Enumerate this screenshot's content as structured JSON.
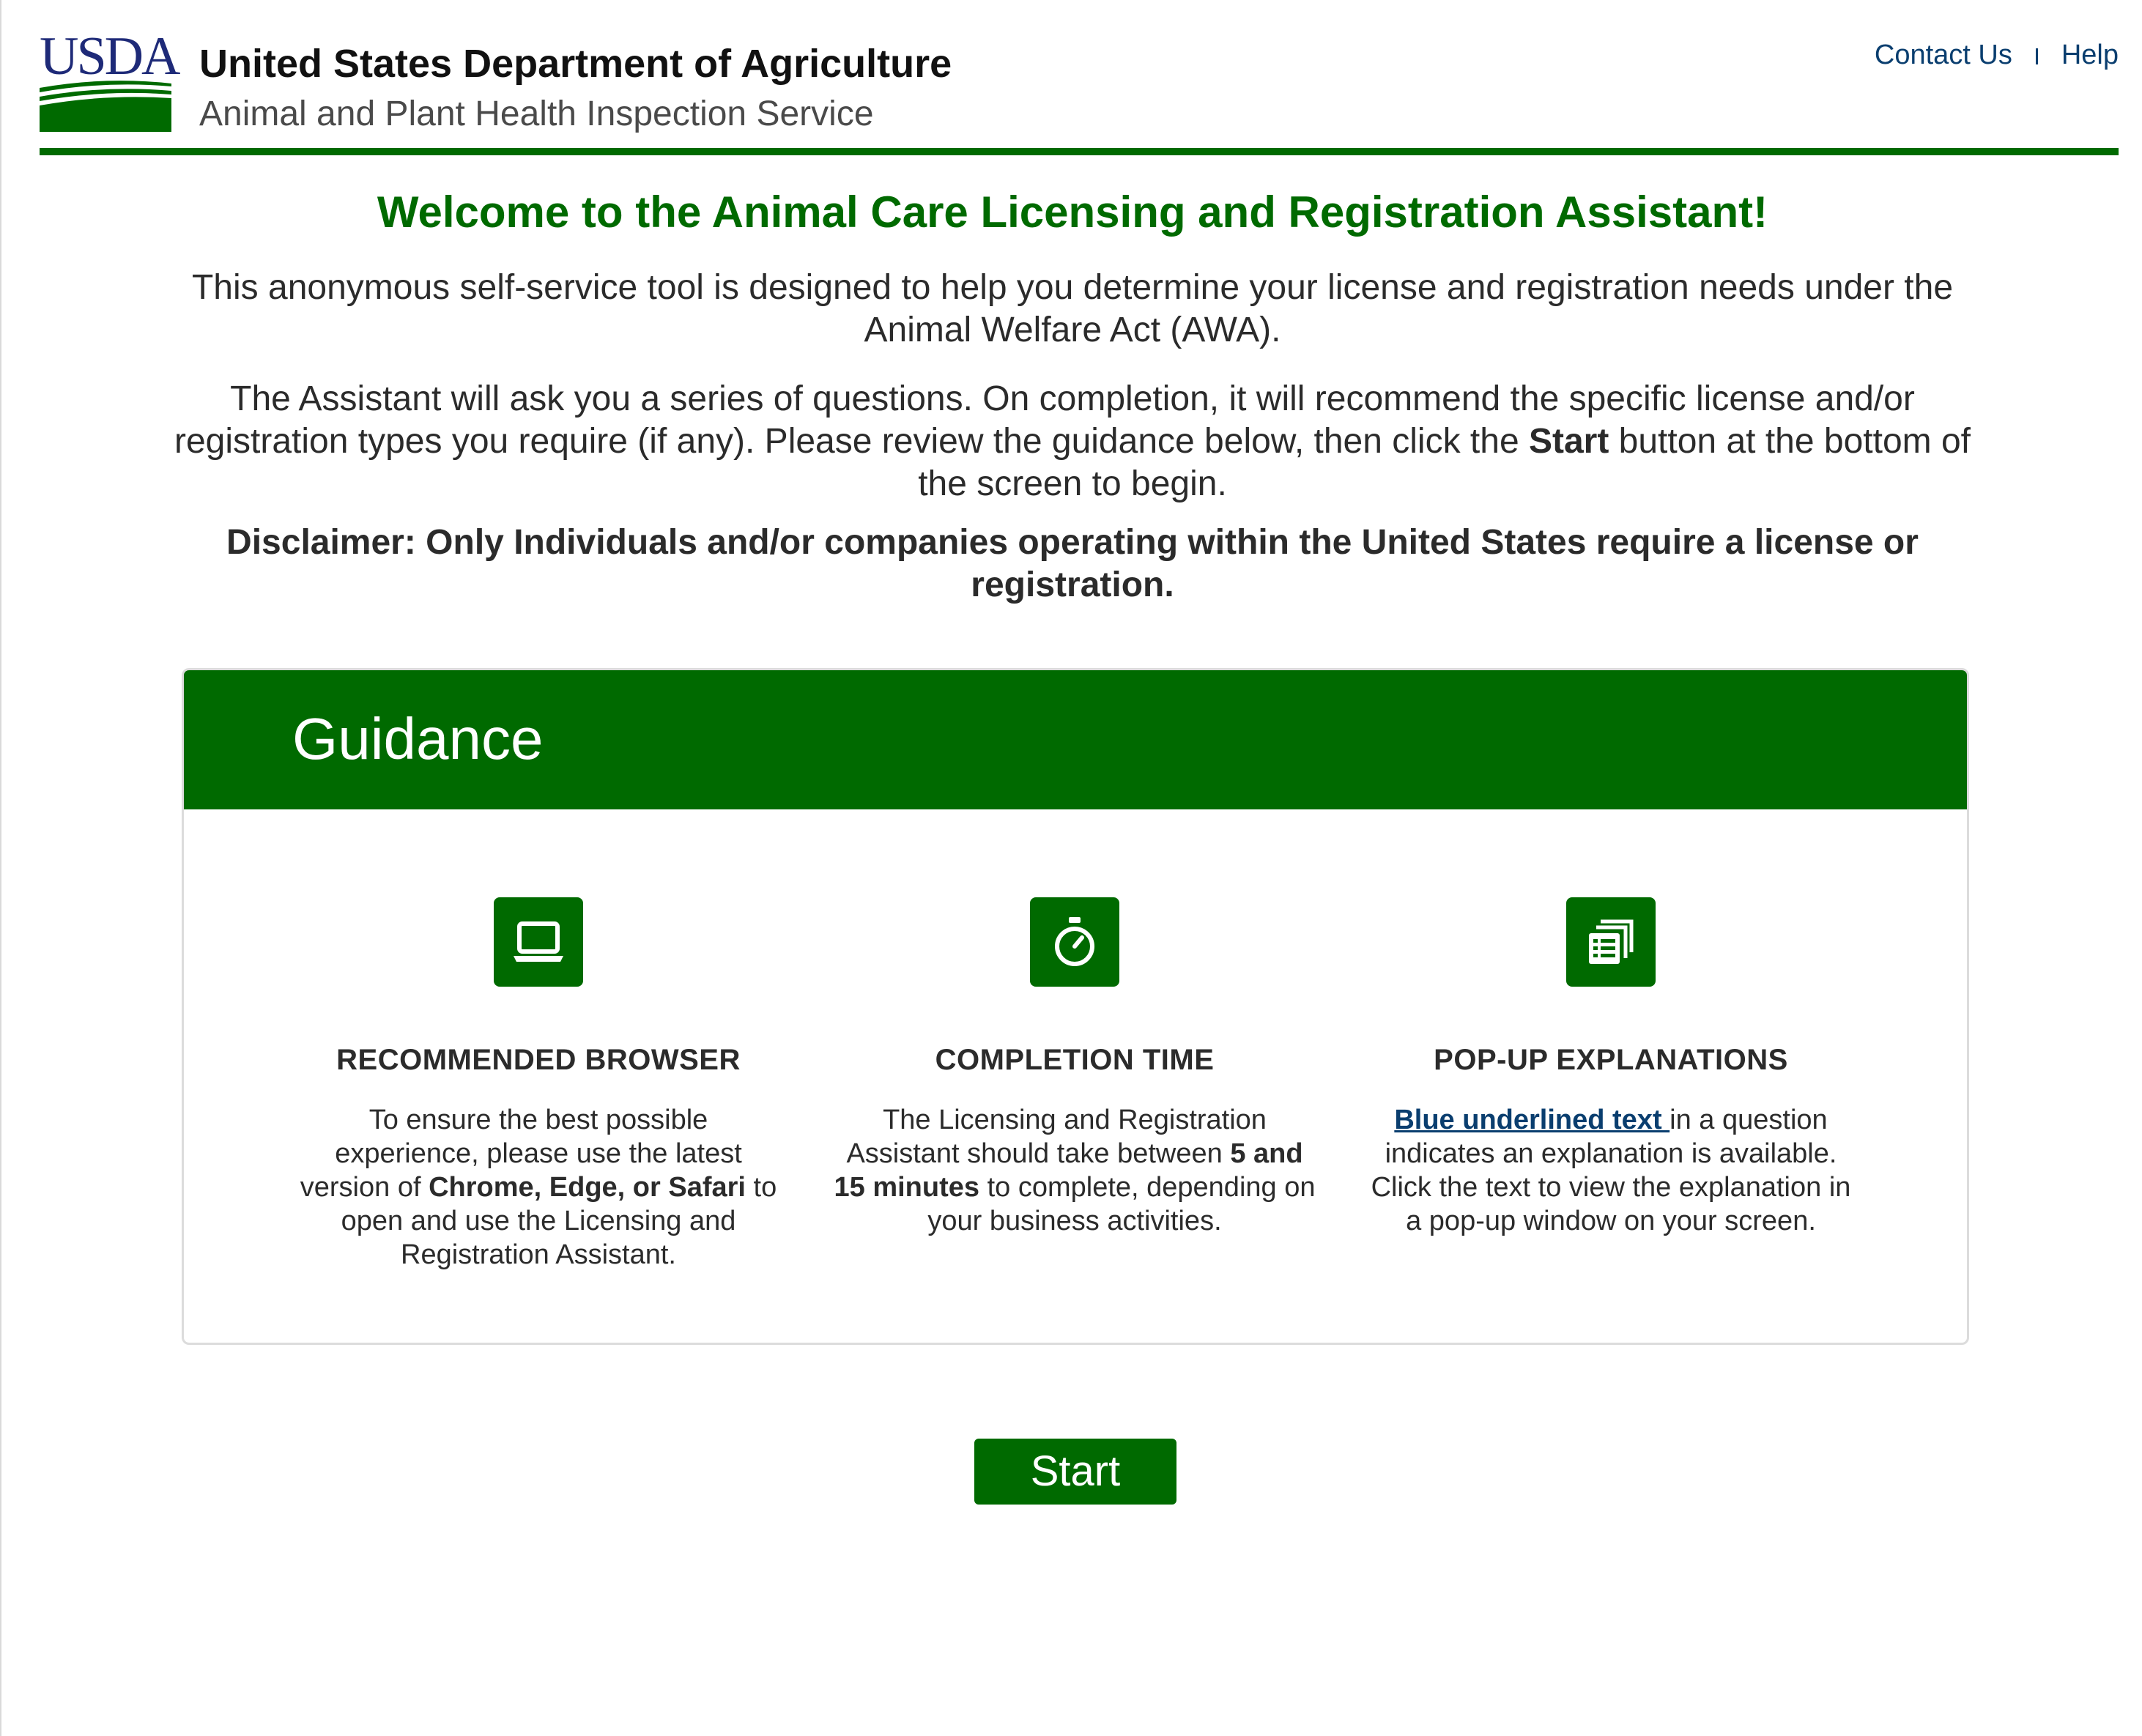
{
  "header": {
    "logo_text": "USDA",
    "agency": "United States Department of Agriculture",
    "subagency": "Animal and Plant Health Inspection Service",
    "links": {
      "contact": "Contact Us",
      "help": "Help"
    }
  },
  "intro": {
    "welcome": "Welcome to the Animal Care Licensing and Registration Assistant!",
    "para1": "This anonymous self-service tool is designed to help you determine your license and registration needs under the Animal Welfare Act (AWA).",
    "para2_before": "The Assistant will ask you a series of questions. On completion, it will recommend the specific license and/or registration types you require (if any). Please review the guidance below, then click the ",
    "para2_bold": "Start",
    "para2_after": " button at the bottom of the screen to begin.",
    "disclaimer": "Disclaimer: Only Individuals and/or companies operating within the United States require a license or registration."
  },
  "guidance": {
    "title": "Guidance",
    "items": [
      {
        "icon": "laptop-icon",
        "title": "RECOMMENDED BROWSER",
        "text_before": "To ensure the best possible experience, please use the latest version of ",
        "text_bold": "Chrome, Edge, or Safari",
        "text_after": " to open and use the Licensing and Registration Assistant."
      },
      {
        "icon": "stopwatch-icon",
        "title": "COMPLETION TIME",
        "text_before": "The Licensing and Registration Assistant should take between ",
        "text_bold": "5 and 15 minutes",
        "text_after": " to complete, depending on your business activities."
      },
      {
        "icon": "document-list-icon",
        "title": "POP-UP EXPLANATIONS",
        "link_text": "Blue underlined text ",
        "text_after": "in a question indicates an explanation is available. Click the text to view the explanation in a pop-up window on your screen."
      }
    ]
  },
  "start_label": "Start",
  "colors": {
    "brand_green": "#006A00",
    "link_blue": "#0a3e6f",
    "logo_navy": "#1e2a78"
  }
}
